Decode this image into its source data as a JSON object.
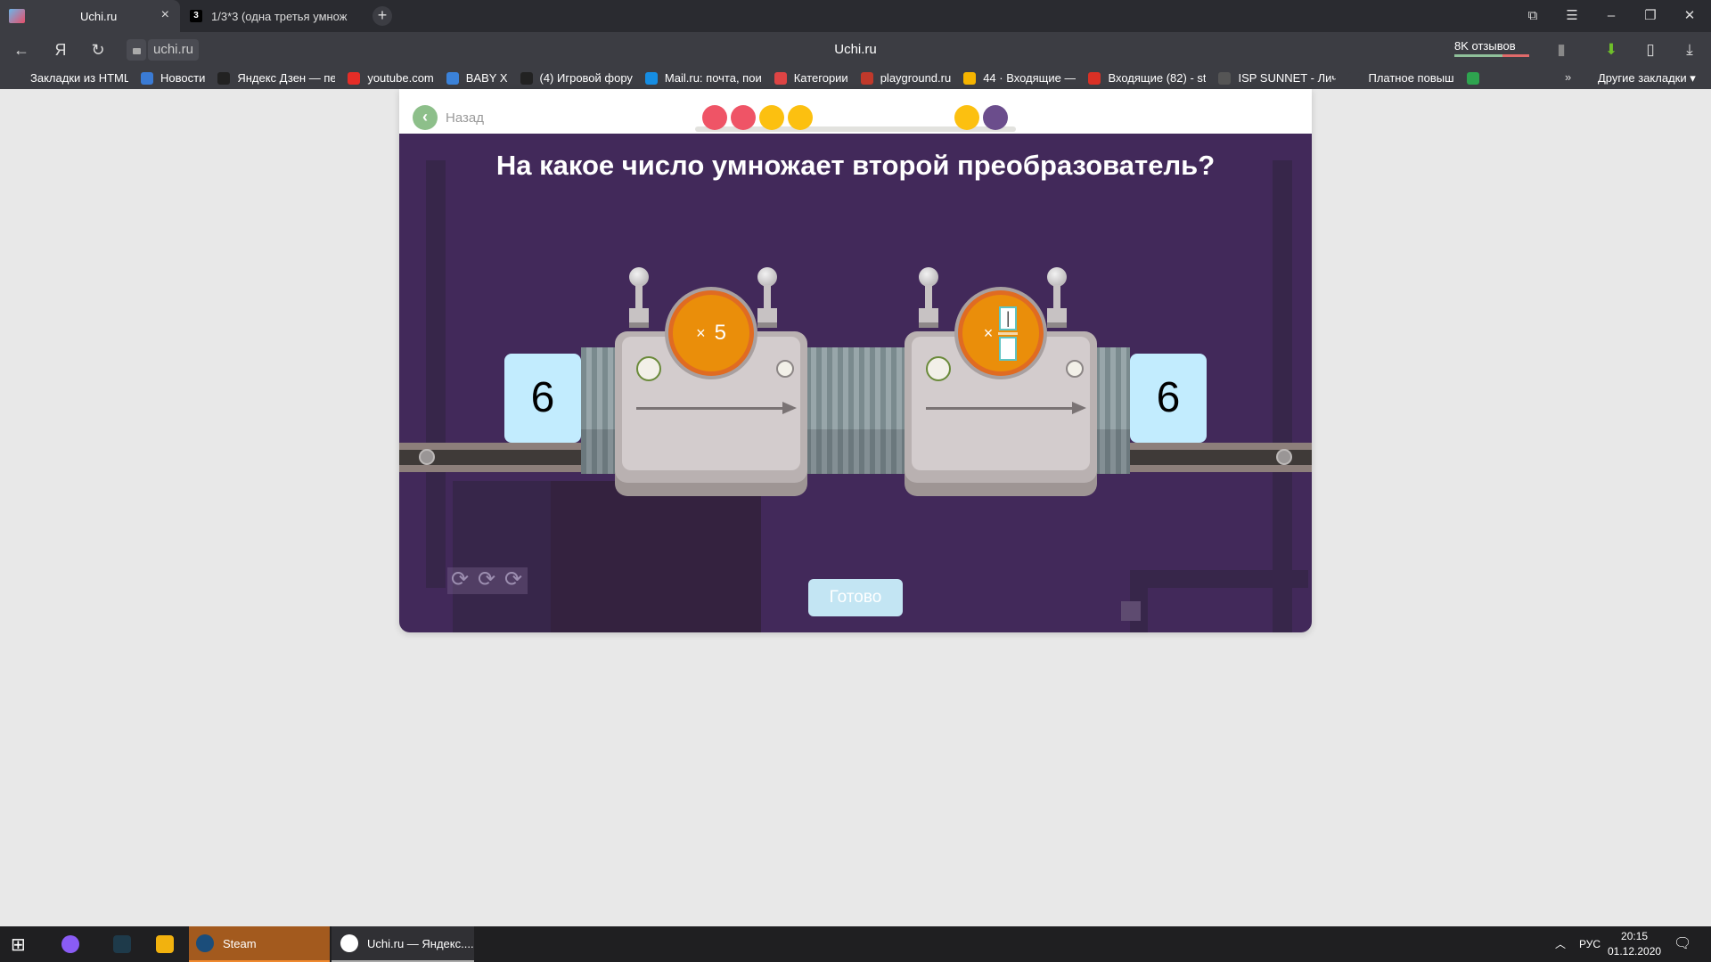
{
  "browser": {
    "tabs": [
      {
        "title": "Uchi.ru",
        "active": true,
        "close_icon": "×"
      },
      {
        "title": "1/3*3 (одна третья умнож",
        "favicon_text": "3",
        "active": false
      }
    ],
    "new_tab_icon": "+",
    "window_controls": {
      "collections": "⧉",
      "menu": "☰",
      "minimize": "–",
      "restore": "❐",
      "close": "✕"
    },
    "nav": {
      "back": "←",
      "yandex": "Я",
      "reload": "↻"
    },
    "url": "uchi.ru",
    "page_title": "Uchi.ru",
    "reviews": "8K отзывов",
    "bookmarks": [
      {
        "label": "Закладки из HTML-фа",
        "color": "#3c3d43",
        "dropdown": "▾"
      },
      {
        "label": "Новости",
        "color": "#3a7bd5"
      },
      {
        "label": "Яндекс Дзен — пе",
        "color": "#222"
      },
      {
        "label": "youtube.com",
        "color": "#e52d27"
      },
      {
        "label": "BABY X",
        "color": "#3b82d9"
      },
      {
        "label": "(4) Игровой фору",
        "color": "#222"
      },
      {
        "label": "Mail.ru: почта, пои",
        "color": "#168de2"
      },
      {
        "label": "Категории",
        "color": "#d44"
      },
      {
        "label": "playground.ru",
        "color": "#c0392b"
      },
      {
        "label": "44 · Входящие — ",
        "color": "#f5b400"
      },
      {
        "label": "Входящие (82) - st",
        "color": "#d93025"
      },
      {
        "label": "ISP SUNNET - Личн",
        "color": "#555"
      },
      {
        "label": "Платное повыш",
        "color": "#3c3d43"
      },
      {
        "label": "",
        "color": "#2ea44f"
      }
    ],
    "bookmarks_more": "»",
    "other_bookmarks": "Другие закладки ▾"
  },
  "game": {
    "back_label": "Назад",
    "progress_dots": [
      "#ef5466",
      "#ef5466",
      "#fcc010",
      "#fcc010",
      "#fcc010",
      "#6b4d8c"
    ],
    "question": "На какое число умножает второй преобразователь?",
    "input_number": "6",
    "output_number": "6",
    "machine1": {
      "operator": "×",
      "value": "5"
    },
    "machine2": {
      "operator": "×",
      "numerator": "|",
      "denominator": ""
    },
    "ready_button": "Готово",
    "gear_icons": [
      "⟳",
      "⟳",
      "⟳"
    ]
  },
  "taskbar": {
    "start_icon": "⊞",
    "apps": [
      {
        "label": "Steam",
        "active": true
      },
      {
        "label": "Uchi.ru — Яндекс...."
      }
    ],
    "tray_chevron": "︿",
    "language": "РУС",
    "time": "20:15",
    "date": "01.12.2020",
    "notification_icon": "🗨"
  }
}
